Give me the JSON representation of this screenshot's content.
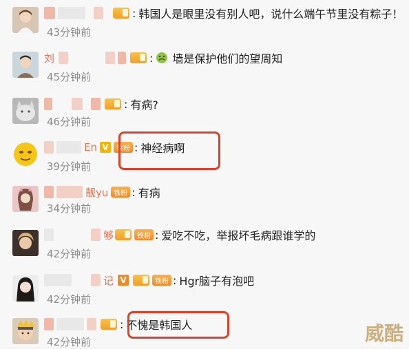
{
  "comments": [
    {
      "name_visible": "",
      "message": "韩国人是眼里没有别人吧，说什么端午节里没有粽子！",
      "time": "43分钟前"
    },
    {
      "name_visible": "刘",
      "message": "墙是保护他们的望周知",
      "time": "45分钟前"
    },
    {
      "name_visible": "",
      "message": "有病?",
      "time": "46分钟前"
    },
    {
      "name_visible": "En",
      "message": "神经病啊",
      "time": "39分钟前"
    },
    {
      "name_visible": "靓yu",
      "message": "有病",
      "time": "34分钟前"
    },
    {
      "name_visible": "够",
      "message": "爱吃不吃，举报坏毛病跟谁学的",
      "time": "42分钟前"
    },
    {
      "name_visible": "记",
      "message": "Hgr脑子有泡吧",
      "time": "42分钟前"
    },
    {
      "name_visible": "",
      "message": "不愧是韩国人",
      "time": "42分钟前"
    }
  ],
  "badges": {
    "fan": "铁粉",
    "v": "V"
  },
  "colors": {
    "highlight": "#d9432b",
    "name": "#eb7350",
    "time": "#8c8c8c"
  },
  "watermark": "威酷"
}
